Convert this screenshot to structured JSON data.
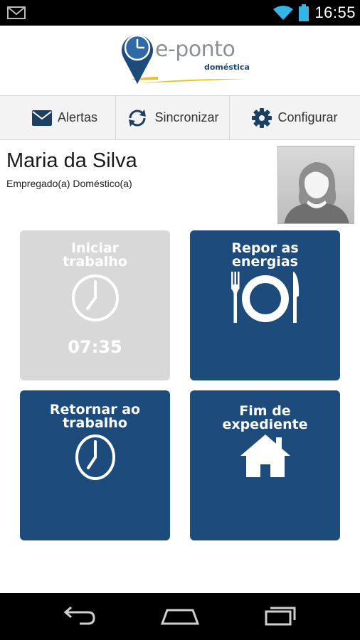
{
  "status_bar": {
    "time": "16:55",
    "icons": [
      "mail-icon",
      "wifi-icon",
      "battery-icon"
    ]
  },
  "header": {
    "logo_text": "e-ponto",
    "logo_subtitle": "doméstica"
  },
  "toolbar": {
    "alerts_label": "Alertas",
    "sync_label": "Sincronizar",
    "config_label": "Configurar"
  },
  "user": {
    "name": "Maria da Silva",
    "role": "Empregado(a) Doméstico(a)"
  },
  "tiles": {
    "start": {
      "line1": "Iniciar",
      "line2": "trabalho",
      "time": "07:35",
      "enabled": false,
      "icon": "clock-icon"
    },
    "rest": {
      "line1": "Repor as",
      "line2": "energias",
      "enabled": true,
      "icon": "plate-cutlery-icon"
    },
    "return": {
      "line1": "Retornar ao",
      "line2": "trabalho",
      "enabled": true,
      "icon": "clock-icon"
    },
    "end": {
      "line1": "Fim de",
      "line2": "expediente",
      "enabled": true,
      "icon": "home-icon"
    }
  },
  "colors": {
    "tile_blue": "#1d4c7c",
    "tile_disabled": "#d8d8d8",
    "logo_grey": "#8c9095"
  },
  "nav_bar": {
    "buttons": [
      "back-icon",
      "home-icon",
      "recent-apps-icon"
    ]
  }
}
